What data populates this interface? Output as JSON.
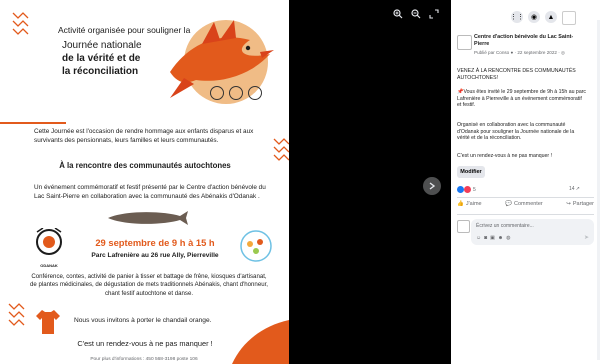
{
  "poster": {
    "header_line1": "Activité organisée pour souligner la",
    "title_line1": "Journée nationale",
    "title_line2": "de la vérité et de",
    "title_line3": "la réconciliation",
    "intro": "Cette Journée est l'occasion de rendre hommage aux enfants disparus et aux survivants des pensionnats, leurs familles et leurs communautés.",
    "heading": "À la rencontre des communautés autochtones",
    "body": "Un événement commémoratif et festif présenté par le Centre d'action bénévole du Lac Saint-Pierre en collaboration avec la communauté des Abénakis d'Odanak .",
    "date_time": "29 septembre de 9 h à 15 h",
    "location": "Parc Lafrenière au 26 rue Ally, Pierreville",
    "activities": "Conférence, contes, activité de panier à tisser et battage de frêne, kiosques d'artisanat, de plantes médicinales, de dégustation de mets traditionnels Abénakis, chant d'honneur, chant festif autochtone et danse.",
    "orange_shirt": "Nous vous invitons à porter le chandail orange.",
    "rendezvous": "C'est un rendez-vous à ne pas manquer !",
    "footer": "Pour plus d'informations : 450 568-3198 poste 106",
    "logo_left_text": "ODANAK",
    "logo_right_text": "Centre d'action bénévole"
  },
  "viewer": {
    "zoom_in_icon": "zoom-in-icon",
    "zoom_out_icon": "zoom-out-icon",
    "fullscreen_icon": "fullscreen-icon",
    "next_icon": "chevron-right-icon"
  },
  "post": {
    "page_name": "Centre d'action bénévole du Lac Saint-Pierre",
    "meta": "Publié par Conso ● · 22 septembre 2022 · ◎",
    "line_heading": "VENEZ À LA RENCONTRE DES COMMUNAUTÉS AUTOCHTONES!",
    "line_para1": "📌Vous êtes invité le 29 septembre de 9h à 15h au parc Lafrenière à Pierreville à un événement commémoratif et festif.",
    "line_para2": "Organisé en collaboration avec la communauté d'Odanak pour souligner la Journée nationale de la vérité et de la réconciliation.",
    "line_para3": "C'est un rendez-vous à ne pas manquer !",
    "edit_button": "Modifier",
    "reaction_count": "5",
    "share_count": "14",
    "like_label": "J'aime",
    "comment_label": "Commenter",
    "share_label": "Partager",
    "comment_placeholder": "Écrivez un commentaire..."
  },
  "colors": {
    "accent_orange": "#e25a1c",
    "fb_blue": "#1877f2"
  }
}
